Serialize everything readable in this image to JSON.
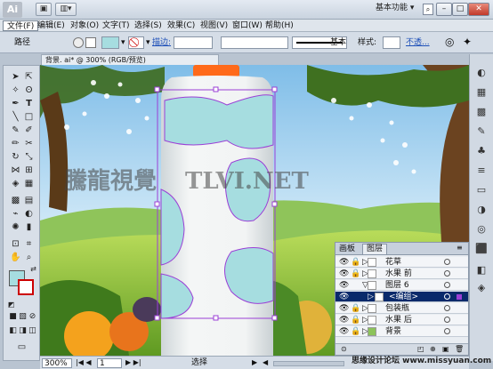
{
  "app": {
    "logo": "Ai",
    "workspace": "基本功能"
  },
  "menus": [
    "文件(F)",
    "编辑(E)",
    "对象(O)",
    "文字(T)",
    "选择(S)",
    "效果(C)",
    "视图(V)",
    "窗口(W)",
    "帮助(H)"
  ],
  "control": {
    "mode": "路径",
    "stroke_label": "描边:",
    "style_basic": "基本",
    "style_label": "样式:",
    "opacity_link": "不透..."
  },
  "document": {
    "tab_title": "背景. ai* @ 300% (RGB/预览)"
  },
  "status": {
    "zoom": "300%",
    "artboard": "1",
    "tool": "选择"
  },
  "layers_panel": {
    "tabs": [
      "画板",
      "图层"
    ],
    "rows": [
      {
        "name": "花草"
      },
      {
        "name": "水果 前"
      },
      {
        "name": "图层 6"
      },
      {
        "name": "<编组>"
      },
      {
        "name": "包装瓶"
      },
      {
        "name": "水果 后"
      },
      {
        "name": "背景"
      }
    ]
  },
  "watermark": "TLVI.NET",
  "watermark_cn": "騰龍視覺",
  "footer_text": "思缘设计论坛 www.missyuan.com",
  "colors": {
    "accent": "#0a2a6b",
    "fill_swatch": "#a6dde0",
    "selection": "#9b3fd6",
    "cap": "#ff6a1a"
  }
}
